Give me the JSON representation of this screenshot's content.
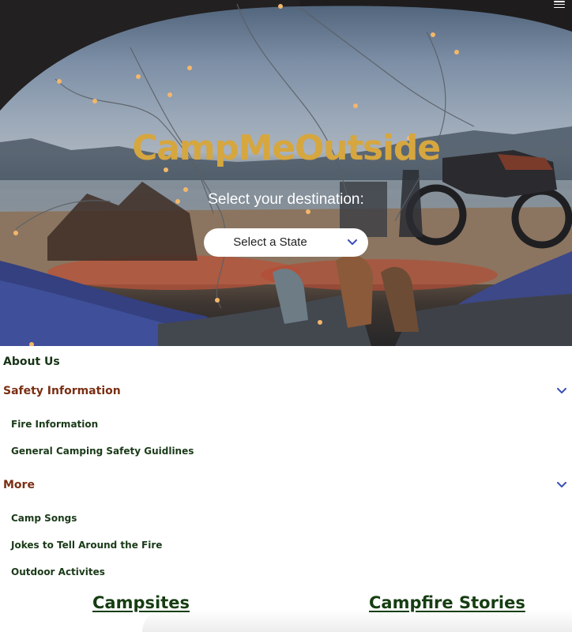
{
  "hero": {
    "title": "CampMeOutside",
    "prompt": "Select your destination:",
    "state_select": {
      "selected": "Select a State"
    },
    "menu_icon": "hamburger-menu-icon"
  },
  "nav": {
    "about_label": "About Us",
    "sections": [
      {
        "label": "Safety Information",
        "icon": "chevron-down-icon",
        "links": [
          "Fire Information",
          "General Camping Safety Guidlines"
        ]
      },
      {
        "label": "More",
        "icon": "chevron-down-icon",
        "links": [
          "Camp Songs",
          "Jokes to Tell Around the Fire",
          "Outdoor Activites"
        ]
      }
    ]
  },
  "footer_links": {
    "campsites": "Campsites",
    "stories": "Campfire Stories"
  },
  "colors": {
    "title_gold": "#d6a63f",
    "section_heading": "#7a2f14",
    "link_green": "#163d12",
    "chevron_blue": "#3a4fb8"
  }
}
